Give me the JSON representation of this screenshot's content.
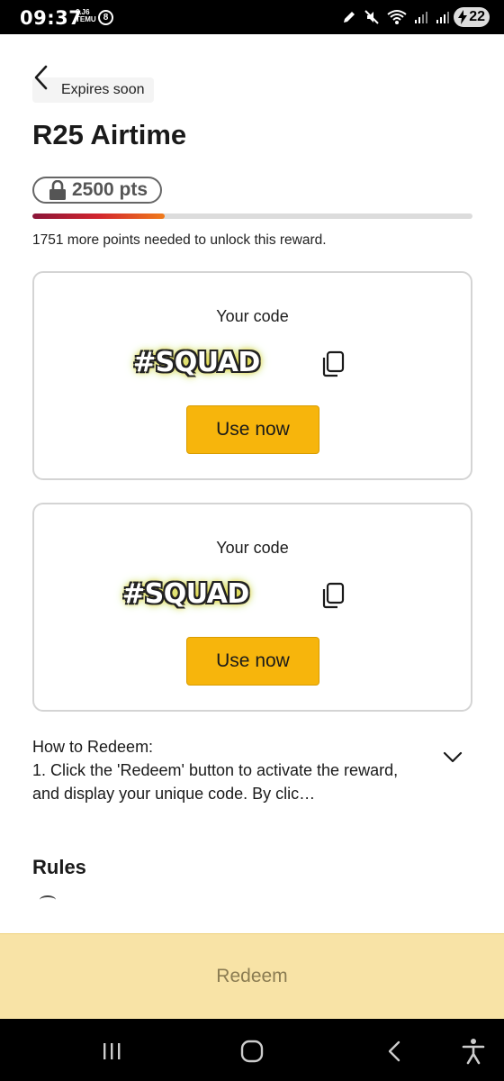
{
  "status_bar": {
    "time": "09:37",
    "temu_label": "TEMU",
    "temu_sublabel": "6.J6",
    "battery": "22"
  },
  "header": {
    "expires_label": "Expires soon",
    "title": "R25 Airtime"
  },
  "points": {
    "required": "2500 pts",
    "progress_fraction": 0.3,
    "needed_text": "1751 more points needed to unlock this reward."
  },
  "codes": [
    {
      "label": "Your code",
      "code": "#SQUAD",
      "button": "Use now"
    },
    {
      "label": "Your code",
      "code": "#SQUAD",
      "button": "Use now"
    }
  ],
  "how_to": {
    "heading": "How to Redeem:",
    "text": "1. Click the 'Redeem' button to activate the reward, and display your unique code. By clic…"
  },
  "rules": {
    "title": "Rules"
  },
  "footer": {
    "redeem_label": "Redeem"
  },
  "colors": {
    "accent": "#f7b50c",
    "redeem_disabled_bg": "#f8e3a6",
    "progress_start": "#8a1538",
    "progress_end": "#f07b1b"
  },
  "icons": [
    "back-icon",
    "lock-icon",
    "copy-icon",
    "chevron-down-icon",
    "recents-icon",
    "home-icon",
    "nav-back-icon",
    "accessibility-icon"
  ]
}
